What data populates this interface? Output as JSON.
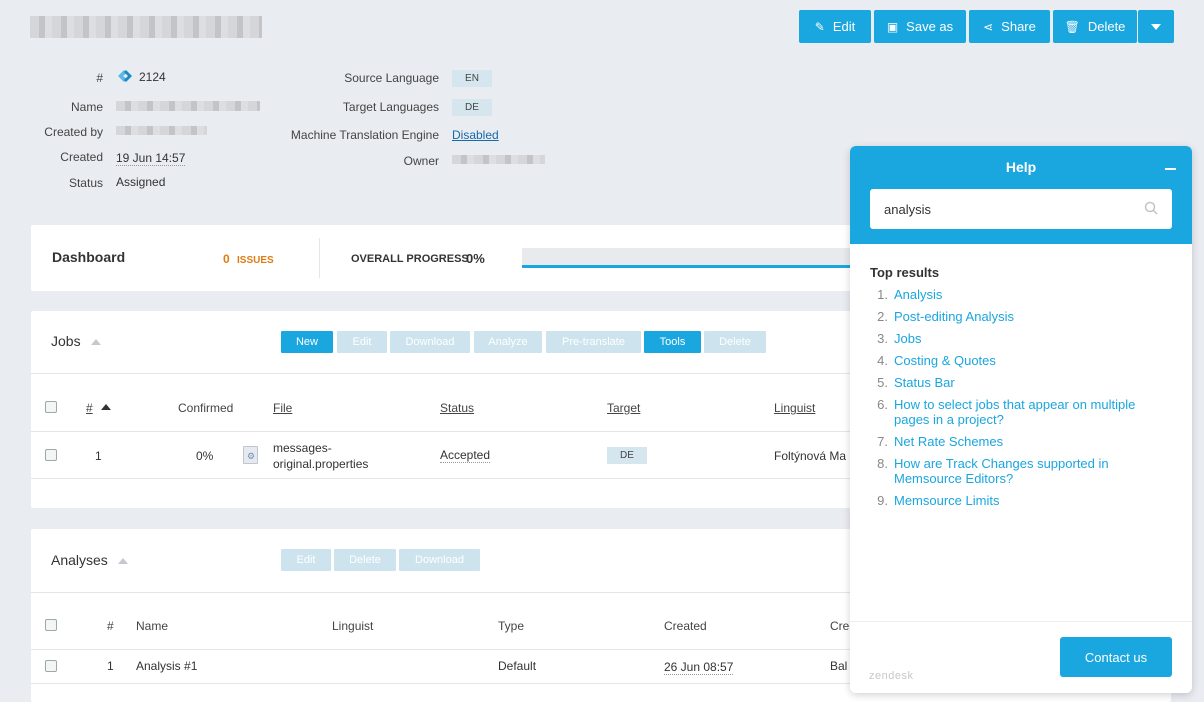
{
  "toolbar": {
    "edit": "Edit",
    "save_as": "Save as",
    "share": "Share",
    "delete": "Delete"
  },
  "project": {
    "id_label": "#",
    "id_value": "2124",
    "name_label": "Name",
    "created_by_label": "Created by",
    "created_label": "Created",
    "created_value": "19 Jun 14:57",
    "status_label": "Status",
    "status_value": "Assigned",
    "source_language_label": "Source Language",
    "source_language_value": "EN",
    "target_languages_label": "Target Languages",
    "target_languages_value": "DE",
    "mt_engine_label": "Machine Translation Engine",
    "mt_engine_value": "Disabled",
    "owner_label": "Owner"
  },
  "dashboard": {
    "title": "Dashboard",
    "issues_count": "0",
    "issues_label": "ISSUES",
    "progress_label": "OVERALL PROGRESS",
    "progress_value": "0%"
  },
  "jobs": {
    "title": "Jobs",
    "buttons": {
      "new": "New",
      "edit": "Edit",
      "download": "Download",
      "analyze": "Analyze",
      "pretranslate": "Pre-translate",
      "tools": "Tools",
      "delete": "Delete"
    },
    "columns": {
      "num": "#",
      "confirmed": "Confirmed",
      "file": "File",
      "status": "Status",
      "target": "Target",
      "linguist": "Linguist"
    },
    "rows": [
      {
        "num": "1",
        "confirmed": "0%",
        "file_line1": "messages-",
        "file_line2": "original.properties",
        "status": "Accepted",
        "target": "DE",
        "linguist": "Foltýnová Ma"
      }
    ]
  },
  "analyses": {
    "title": "Analyses",
    "buttons": {
      "edit": "Edit",
      "delete": "Delete",
      "download": "Download"
    },
    "columns": {
      "num": "#",
      "name": "Name",
      "linguist": "Linguist",
      "type": "Type",
      "created": "Created",
      "created_by": "Cre"
    },
    "rows": [
      {
        "num": "1",
        "name": "Analysis #1",
        "type": "Default",
        "created": "26 Jun 08:57",
        "created_by": "Bal"
      }
    ]
  },
  "help": {
    "title": "Help",
    "search_value": "analysis",
    "results_title": "Top results",
    "results": [
      {
        "num": "1.",
        "text": "Analysis"
      },
      {
        "num": "2.",
        "text": "Post-editing Analysis"
      },
      {
        "num": "3.",
        "text": "Jobs"
      },
      {
        "num": "4.",
        "text": "Costing & Quotes"
      },
      {
        "num": "5.",
        "text": "Status Bar"
      },
      {
        "num": "6.",
        "text": "How to select jobs that appear on multiple pages in a project?"
      },
      {
        "num": "7.",
        "text": "Net Rate Schemes"
      },
      {
        "num": "8.",
        "text": "How are Track Changes supported in Memsource Editors?"
      },
      {
        "num": "9.",
        "text": "Memsource Limits"
      }
    ],
    "footer_brand": "zendesk",
    "contact_button": "Contact us"
  },
  "colors": {
    "accent": "#1aa6de",
    "issues": "#e07b14",
    "background": "#e9ecf1"
  }
}
